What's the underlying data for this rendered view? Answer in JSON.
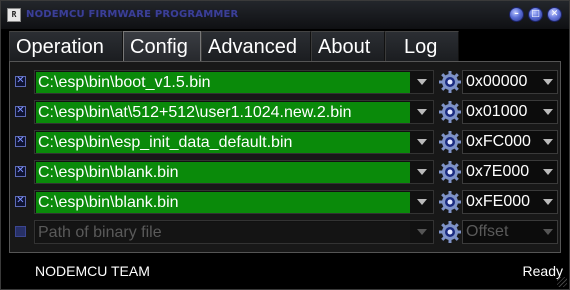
{
  "window": {
    "title": "NODEMCU FIRMWARE PROGRAMMER",
    "app_icon_glyph": "R",
    "controls": {
      "minimize": "–",
      "maximize": "□",
      "close": "✕"
    }
  },
  "tabs": [
    {
      "label": "Operation",
      "active": false
    },
    {
      "label": "Config",
      "active": true
    },
    {
      "label": "Advanced",
      "active": false
    },
    {
      "label": "About",
      "active": false
    },
    {
      "label": "Log",
      "active": false
    }
  ],
  "config": {
    "rows": [
      {
        "checked": true,
        "path": "C:\\esp\\bin\\boot_v1.5.bin",
        "offset": "0x00000"
      },
      {
        "checked": true,
        "path": "C:\\esp\\bin\\at\\512+512\\user1.1024.new.2.bin",
        "offset": "0x01000"
      },
      {
        "checked": true,
        "path": "C:\\esp\\bin\\esp_init_data_default.bin",
        "offset": "0xFC000"
      },
      {
        "checked": true,
        "path": "C:\\esp\\bin\\blank.bin",
        "offset": "0x7E000"
      },
      {
        "checked": true,
        "path": "C:\\esp\\bin\\blank.bin",
        "offset": "0xFE000"
      },
      {
        "checked": false,
        "path_placeholder": "Path of binary file",
        "offset_placeholder": "Offset"
      }
    ],
    "icons": {
      "checkbox": "checkbox-icon",
      "dropdown": "chevron-down-icon",
      "browse": "gear-icon"
    },
    "colors": {
      "path_bg": "#0a8a0a",
      "checkbox_accent": "#5d6ab5"
    }
  },
  "status": {
    "left": "NODEMCU TEAM",
    "right": "Ready"
  }
}
